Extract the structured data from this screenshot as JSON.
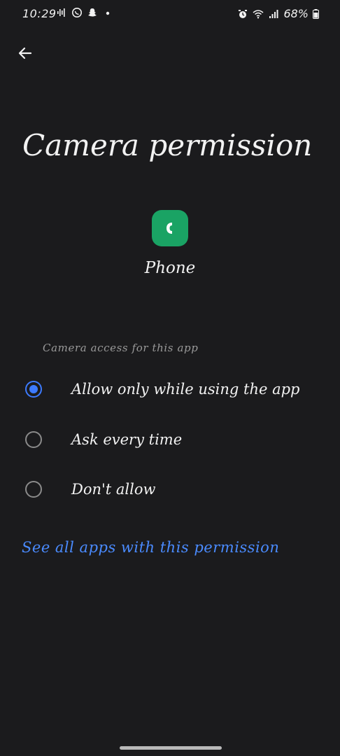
{
  "status_bar": {
    "time": "10:29",
    "left_icons": [
      "audio-wave-icon",
      "whatsapp-icon",
      "snapchat-icon",
      "dot-icon"
    ],
    "right_icons": [
      "alarm-icon",
      "wifi-icon",
      "signal-icon",
      "battery-icon"
    ],
    "battery_text": "68%"
  },
  "header": {
    "back_icon": "back-arrow-icon",
    "title": "Camera permission"
  },
  "app": {
    "name": "Phone",
    "icon": "phone-app-icon",
    "icon_color": "#1aa364"
  },
  "section": {
    "label": "Camera access for this app"
  },
  "options": [
    {
      "label": "Allow only while using the app",
      "selected": true
    },
    {
      "label": "Ask every time",
      "selected": false
    },
    {
      "label": "Don't allow",
      "selected": false
    }
  ],
  "link": {
    "label": "See all apps with this permission"
  },
  "colors": {
    "background": "#1b1b1d",
    "accent": "#3d7bff",
    "link": "#4a8bff"
  }
}
